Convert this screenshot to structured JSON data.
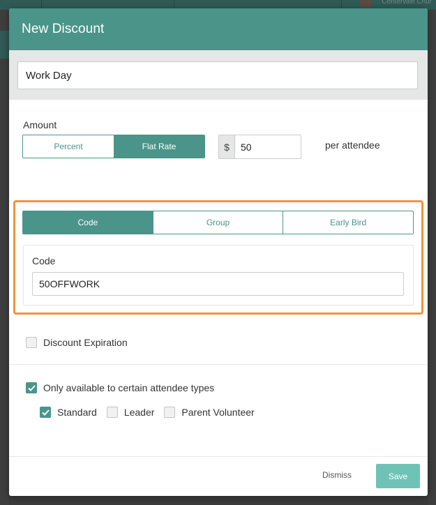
{
  "background": {
    "org_name": "Centerville Chur"
  },
  "modal": {
    "title": "New Discount",
    "name_value": "Work Day",
    "amount": {
      "label": "Amount",
      "modes": [
        {
          "label": "Percent",
          "active": false
        },
        {
          "label": "Flat Rate",
          "active": true
        }
      ],
      "currency_symbol": "$",
      "value": "50",
      "suffix": "per attendee"
    },
    "discount_type": {
      "tabs": [
        {
          "label": "Code",
          "active": true
        },
        {
          "label": "Group",
          "active": false
        },
        {
          "label": "Early Bird",
          "active": false
        }
      ],
      "code_label": "Code",
      "code_value": "50OFFWORK"
    },
    "expiration": {
      "label": "Discount Expiration",
      "checked": false
    },
    "attendee_types": {
      "label": "Only available to certain attendee types",
      "checked": true,
      "options": [
        {
          "label": "Standard",
          "checked": true
        },
        {
          "label": "Leader",
          "checked": false
        },
        {
          "label": "Parent Volunteer",
          "checked": false
        }
      ]
    },
    "footer": {
      "dismiss_label": "Dismiss",
      "save_label": "Save"
    }
  },
  "colors": {
    "accent": "#4a948a",
    "save": "#6fc3b6",
    "highlight": "#f0953a"
  }
}
